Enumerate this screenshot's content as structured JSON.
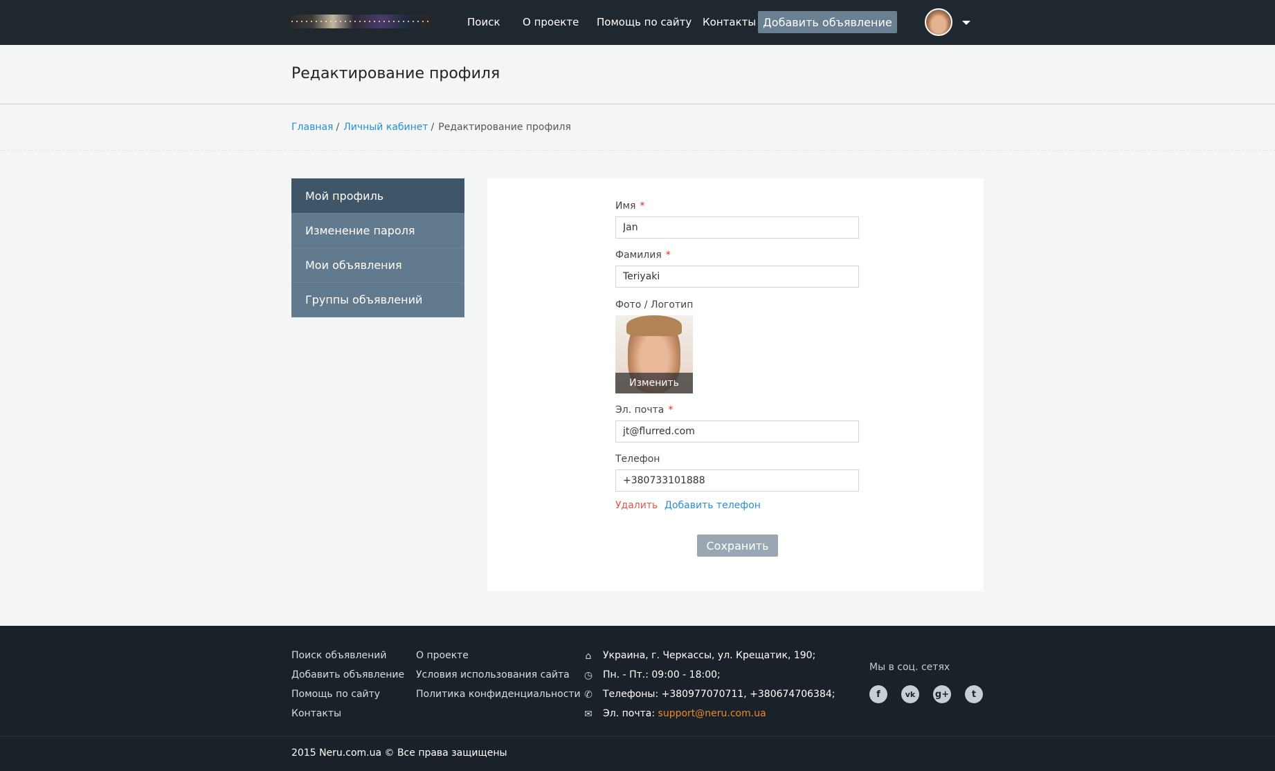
{
  "header": {
    "nav": [
      "Поиск",
      "О проекте",
      "Помощь по сайту",
      "Контакты"
    ],
    "add_listing": "Добавить объявление"
  },
  "page": {
    "title": "Редактирование профиля"
  },
  "breadcrumb": {
    "home": "Главная",
    "account": "Личный кабинет",
    "current": "Редактирование профиля"
  },
  "sidebar": {
    "items": [
      "Мой профиль",
      "Изменение пароля",
      "Мои объявления",
      "Группы объявлений"
    ]
  },
  "form": {
    "first_name_label": "Имя",
    "first_name_value": "Jan",
    "last_name_label": "Фамилия",
    "last_name_value": "Teriyaki",
    "photo_label": "Фото / Логотип",
    "photo_change": "Изменить",
    "email_label": "Эл. почта",
    "email_value": "jt@flurred.com",
    "phone_label": "Телефон",
    "phone_value": "+380733101888",
    "required_mark": "*",
    "delete_link": "Удалить",
    "add_phone_link": "Добавить телефон",
    "save": "Сохранить"
  },
  "footer": {
    "col1": [
      "Поиск объявлений",
      "Добавить объявление",
      "Помощь по сайту",
      "Контакты"
    ],
    "col2": [
      "О проекте",
      "Условия использования сайта",
      "Политика конфиденциальности"
    ],
    "address": "Украина, г. Черкассы, ул. Крещатик, 190;",
    "hours": "Пн. - Пт.: 09:00 - 18:00;",
    "phones": "Телефоны: +380977070711, +380674706384;",
    "email_prefix": "Эл. почта:",
    "email": "support@neru.com.ua",
    "social_title": "Мы в соц. сетях",
    "social": [
      "f",
      "vk",
      "g+",
      "t"
    ],
    "copyright": "2015 Neru.com.ua © Все права защищены"
  },
  "colors": {
    "header_bg": "#1f272f",
    "sidebar_active": "#3f5568",
    "sidebar_item": "#617a8d",
    "link": "#2a8dd4",
    "danger": "#e2564a",
    "accent_orange": "#e98a2a"
  }
}
